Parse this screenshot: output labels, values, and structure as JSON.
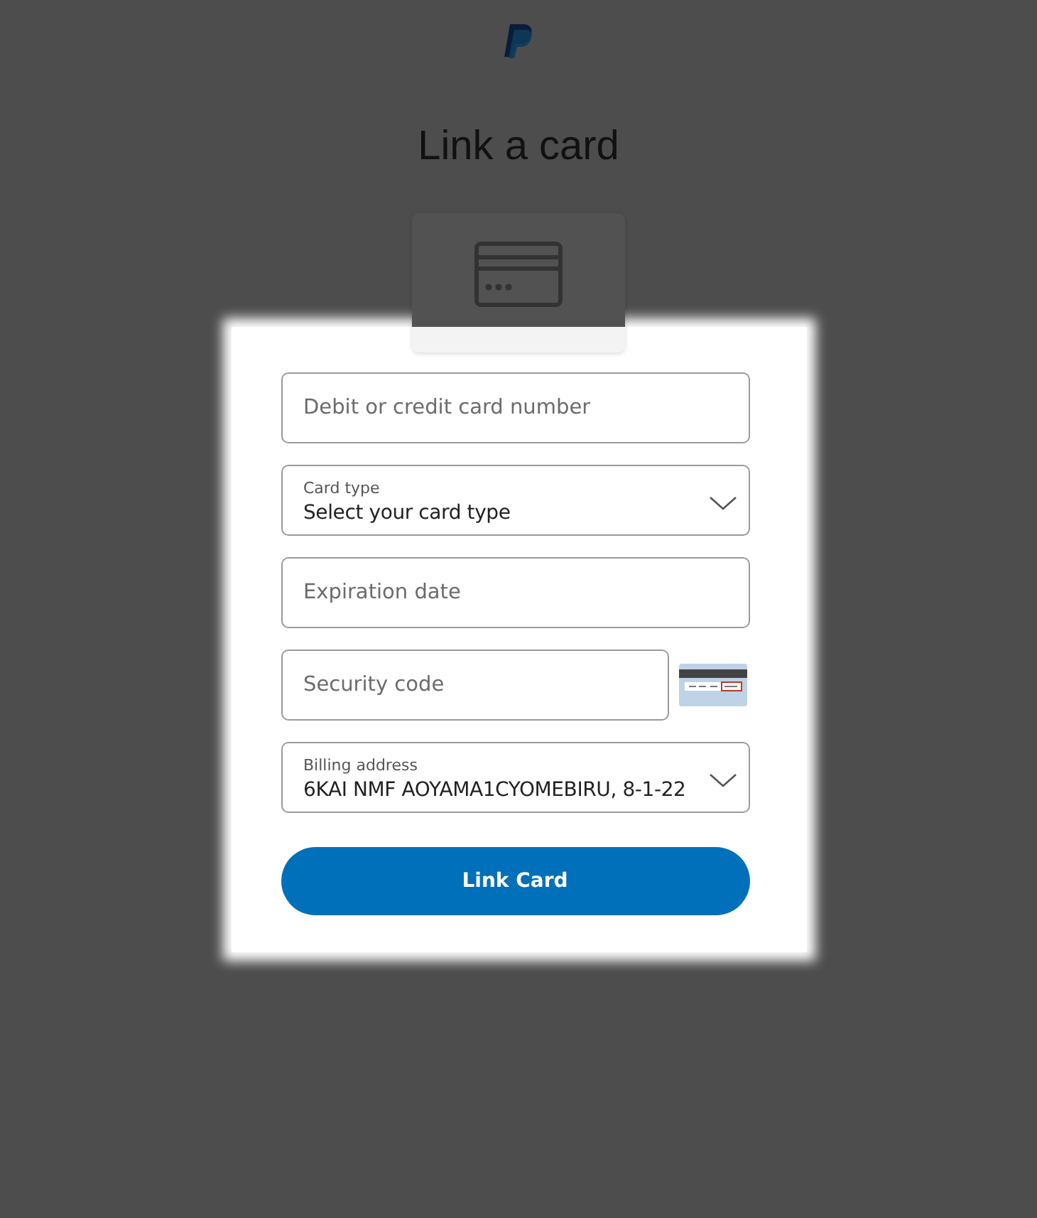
{
  "title": "Link a card",
  "fields": [
    {
      "kind": "input",
      "placeholder": "Debit or credit card number"
    },
    {
      "kind": "select",
      "label": "Card type",
      "value": "Select your card type"
    },
    {
      "kind": "input",
      "placeholder": "Expiration date"
    },
    {
      "kind": "cvv",
      "placeholder": "Security code"
    },
    {
      "kind": "select",
      "label": "Billing address",
      "value": "6KAI NMF AOYAMA1CYOMEBIRU, 8-1-22"
    }
  ],
  "button": "Link Card"
}
